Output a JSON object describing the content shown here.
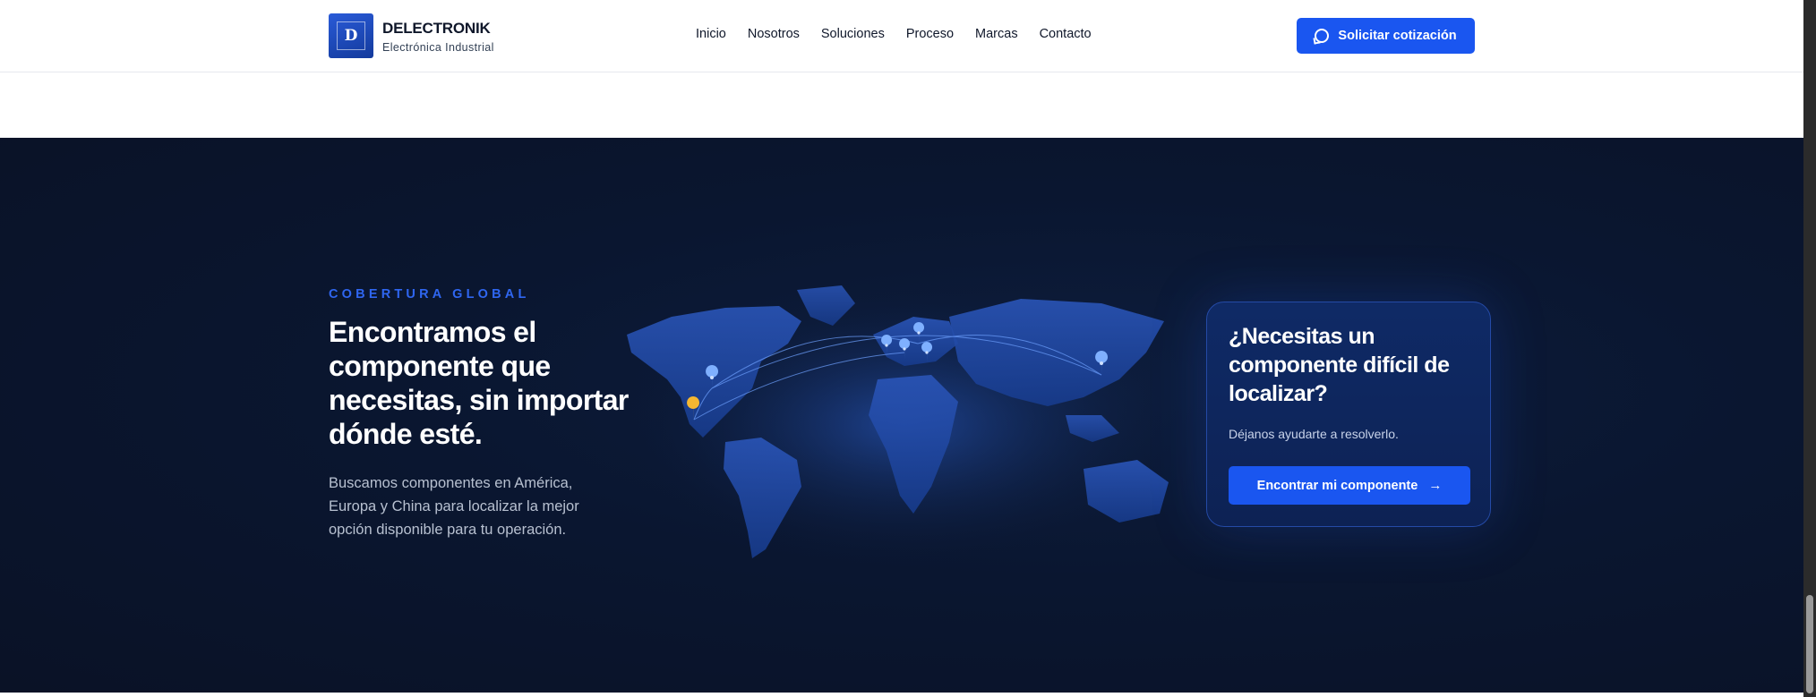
{
  "header": {
    "logo_mark": "D",
    "brand_name": "DELECTRONIK",
    "brand_subtitle": "Electrónica Industrial",
    "nav": [
      {
        "label": "Inicio"
      },
      {
        "label": "Nosotros"
      },
      {
        "label": "Soluciones"
      },
      {
        "label": "Proceso"
      },
      {
        "label": "Marcas"
      },
      {
        "label": "Contacto"
      }
    ],
    "quote_button": {
      "label": "Solicitar cotización",
      "icon": "whatsapp-icon"
    }
  },
  "coverage": {
    "eyebrow": "COBERTURA GLOBAL",
    "headline": "Encontramos el componente que necesitas, sin importar dónde esté.",
    "lead": "Buscamos componentes en América, Europa y China para localizar la mejor opción disponible para tu operación.",
    "map_icon": "world-map-illustration"
  },
  "cta_card": {
    "title": "¿Necesitas un componente difícil de localizar?",
    "text": "Déjanos ayudarte a resolverlo.",
    "button_label": "Encontrar mi componente",
    "button_icon": "arrow-right-icon"
  },
  "colors": {
    "accent": "#1a56f0",
    "section_bg": "#0a1630",
    "eyebrow": "#2f66f0",
    "pin_highlight": "#f5b731"
  }
}
